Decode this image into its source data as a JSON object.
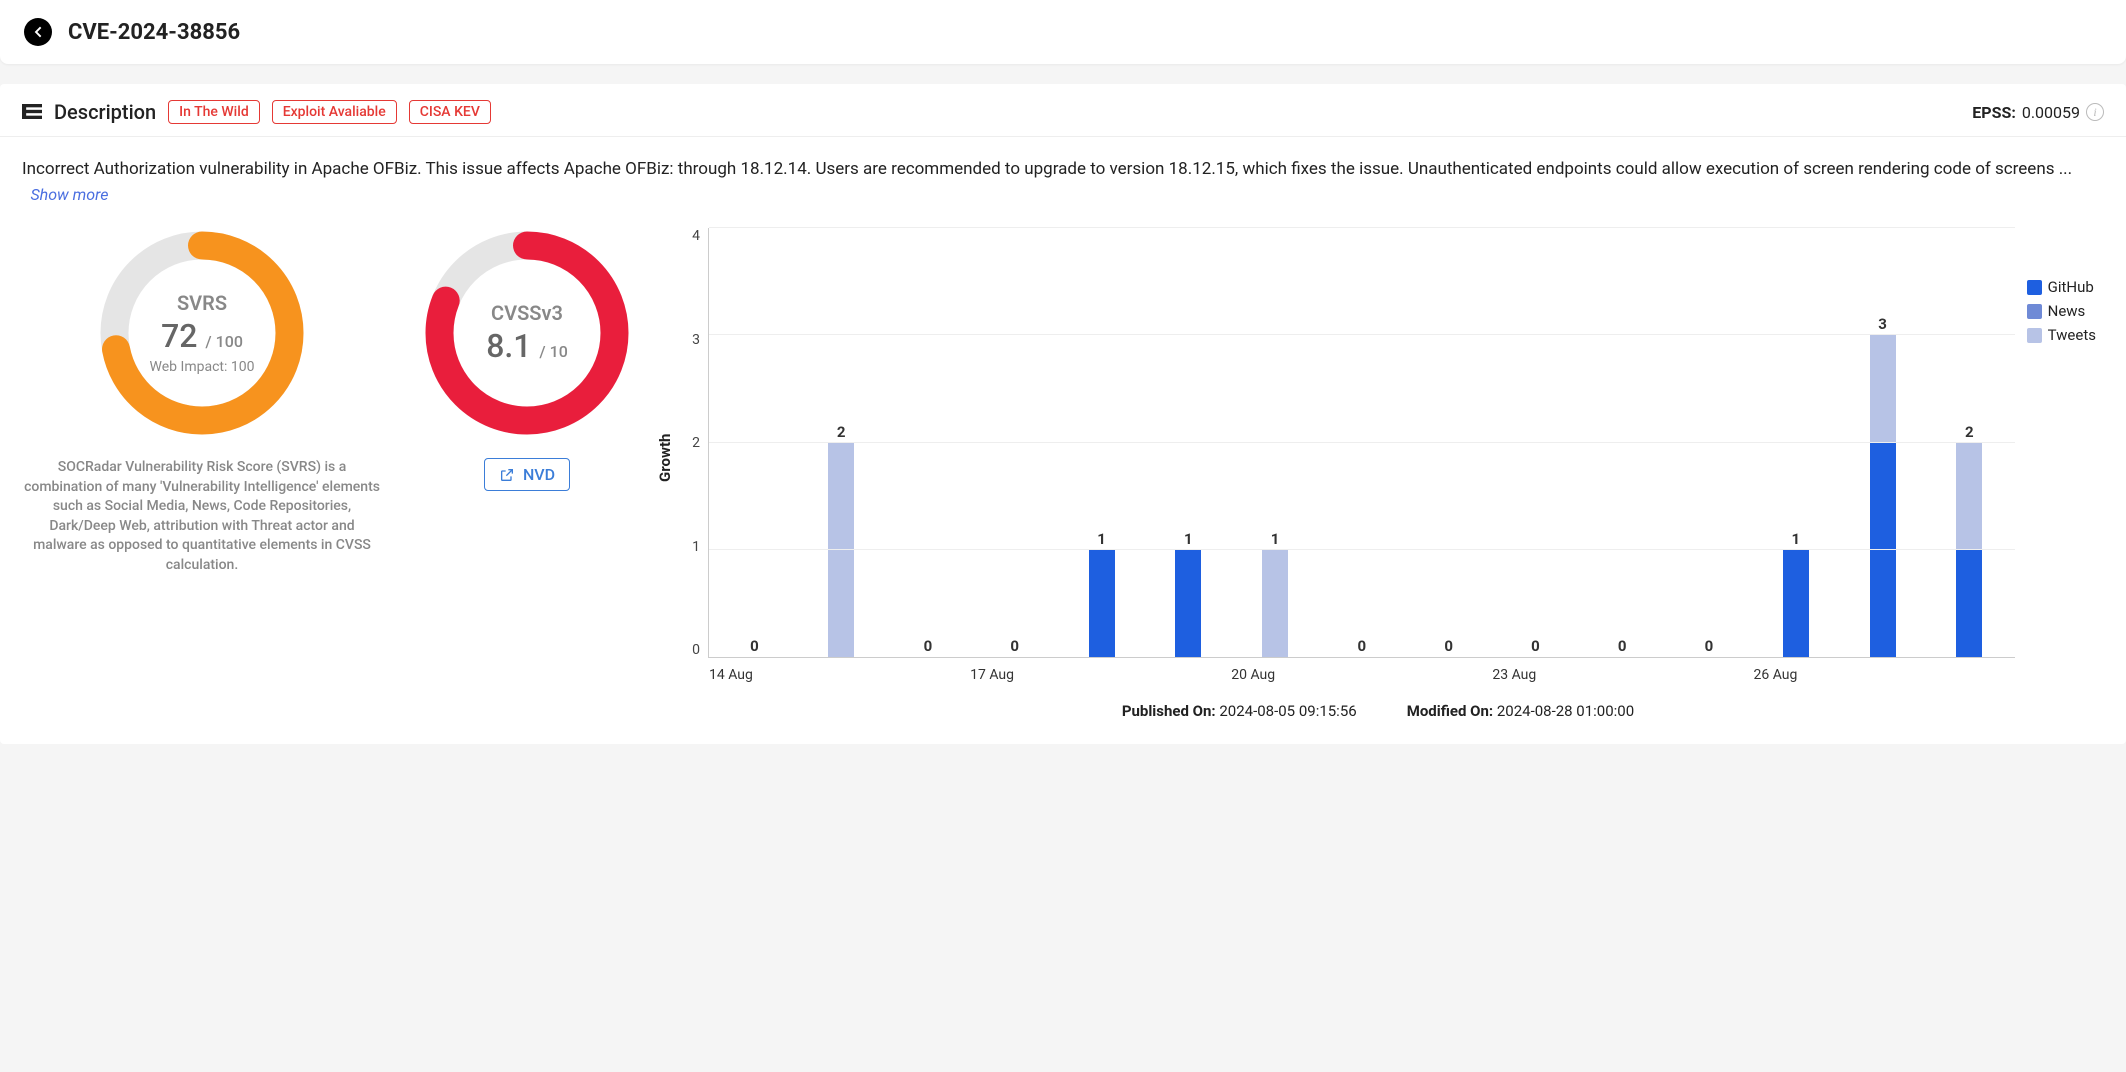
{
  "header": {
    "title": "CVE-2024-38856"
  },
  "section": {
    "title": "Description",
    "badges": [
      "In The Wild",
      "Exploit Avaliable",
      "CISA KEV"
    ],
    "epss_label": "EPSS:",
    "epss_value": "0.00059"
  },
  "description": {
    "text": "Incorrect Authorization vulnerability in Apache OFBiz. This issue affects Apache OFBiz: through 18.12.14. Users are recommended to upgrade to version 18.12.15, which fixes the issue. Unauthenticated endpoints could allow execution of screen rendering code of screens ...",
    "show_more": "Show more"
  },
  "svrs": {
    "label": "SVRS",
    "value": "72",
    "max": "/ 100",
    "sub": "Web Impact: 100",
    "caption": "SOCRadar Vulnerability Risk Score (SVRS) is a combination of many 'Vulnerability Intelligence' elements such as Social Media, News, Code Repositories, Dark/Deep Web, attribution with Threat actor and malware as opposed to quantitative elements in CVSS calculation.",
    "percent": 72,
    "color": "#f7931e"
  },
  "cvss": {
    "label": "CVSSv3",
    "value": "8.1",
    "max": "/ 10",
    "percent": 81,
    "color": "#e91e3c",
    "nvd_label": "NVD"
  },
  "legend": [
    {
      "name": "GitHub",
      "color": "#1e5fe0"
    },
    {
      "name": "News",
      "color": "#6f8ad6"
    },
    {
      "name": "Tweets",
      "color": "#b7c3e6"
    }
  ],
  "chart_data": {
    "type": "bar",
    "title": "",
    "ylabel": "Growth",
    "xlabel": "",
    "ylim": [
      0,
      4
    ],
    "yticks": [
      0,
      1,
      2,
      3,
      4
    ],
    "x_tick_labels": [
      "14 Aug",
      "17 Aug",
      "20 Aug",
      "23 Aug",
      "26 Aug"
    ],
    "bars": [
      {
        "label": "0",
        "value": 0,
        "series": "GitHub"
      },
      {
        "label": "2",
        "value": 2,
        "series": "Tweets"
      },
      {
        "label": "0",
        "value": 0,
        "series": "GitHub"
      },
      {
        "label": "0",
        "value": 0,
        "series": "GitHub"
      },
      {
        "label": "1",
        "value": 1,
        "series": "GitHub"
      },
      {
        "label": "1",
        "value": 1,
        "series": "GitHub"
      },
      {
        "label": "1",
        "value": 1,
        "series": "Tweets"
      },
      {
        "label": "0",
        "value": 0,
        "series": "GitHub"
      },
      {
        "label": "0",
        "value": 0,
        "series": "GitHub"
      },
      {
        "label": "0",
        "value": 0,
        "series": "GitHub"
      },
      {
        "label": "0",
        "value": 0,
        "series": "GitHub"
      },
      {
        "label": "0",
        "value": 0,
        "series": "GitHub"
      },
      {
        "label": "1",
        "value": 1,
        "series": "GitHub"
      },
      {
        "label": "3",
        "value": 3,
        "series": "Tweets",
        "overlay": {
          "value": 2,
          "series": "GitHub"
        }
      },
      {
        "label": "2",
        "value": 2,
        "series": "Tweets",
        "overlay": {
          "value": 1,
          "series": "GitHub"
        }
      }
    ]
  },
  "meta": {
    "published_label": "Published On:",
    "published_value": "2024-08-05 09:15:56",
    "modified_label": "Modified On:",
    "modified_value": "2024-08-28 01:00:00"
  }
}
